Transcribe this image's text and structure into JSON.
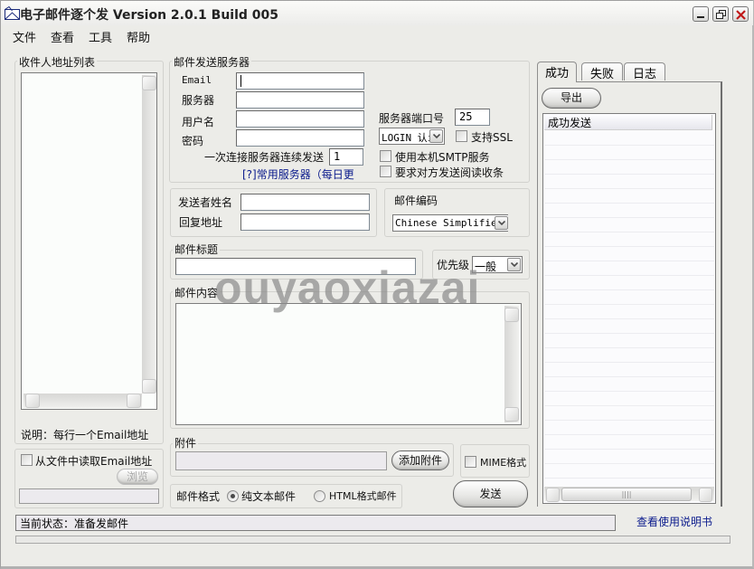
{
  "window": {
    "title": "电子邮件逐个发 Version 2.0.1 Build 005",
    "controls": {
      "minimize": "minimize",
      "restore": "restore",
      "close": "close"
    }
  },
  "menu": [
    "文件",
    "查看",
    "工具",
    "帮助"
  ],
  "recipients": {
    "group_label": "收件人地址列表",
    "note": "说明：每行一个Email地址",
    "read_from_file_label": "从文件中读取Email地址",
    "read_from_file_checked": false,
    "browse_label": "浏览",
    "file_path_value": ""
  },
  "server": {
    "group_label": "邮件发送服务器",
    "email_label": "Email",
    "email_value": "",
    "server_label": "服务器",
    "server_value": "",
    "username_label": "用户名",
    "username_value": "",
    "password_label": "密码",
    "password_value": "",
    "port_label": "服务器端口号",
    "port_value": "25",
    "auth_select_value": "LOGIN 认i",
    "ssl_label": "支持SSL",
    "ssl_checked": false,
    "local_smtp_label": "使用本机SMTP服务",
    "local_smtp_checked": false,
    "read_receipt_label": "要求对方发送阅读收条",
    "read_receipt_checked": false,
    "consecutive_label": "一次连接服务器连续发送",
    "consecutive_value": "1",
    "common_servers_link": "[?]常用服务器（每日更"
  },
  "sender": {
    "name_label": "发送者姓名",
    "name_value": "",
    "reply_label": "回复地址",
    "reply_value": ""
  },
  "encoding": {
    "group_label": "邮件编码",
    "selected": "Chinese Simplified"
  },
  "subject": {
    "group_label": "邮件标题",
    "value": ""
  },
  "priority": {
    "label": "优先级",
    "selected": "一般"
  },
  "body": {
    "label": "邮件内容",
    "value": ""
  },
  "attachment": {
    "group_label": "附件",
    "value": "",
    "add_button": "添加附件",
    "mime_label": "MIME格式",
    "mime_checked": false
  },
  "format": {
    "label": "邮件格式",
    "options": [
      "纯文本邮件",
      "HTML格式邮件"
    ],
    "selected": "纯文本邮件"
  },
  "send_button": "发送",
  "results": {
    "tabs": [
      "成功",
      "失败",
      "日志"
    ],
    "active_tab": "成功",
    "export_button": "导出",
    "list_header": "成功发送",
    "items": []
  },
  "status": {
    "text": "当前状态：准备发邮件",
    "manual_link": "查看使用说明书",
    "progress": 0
  },
  "watermark": "ouyaoxiazai"
}
